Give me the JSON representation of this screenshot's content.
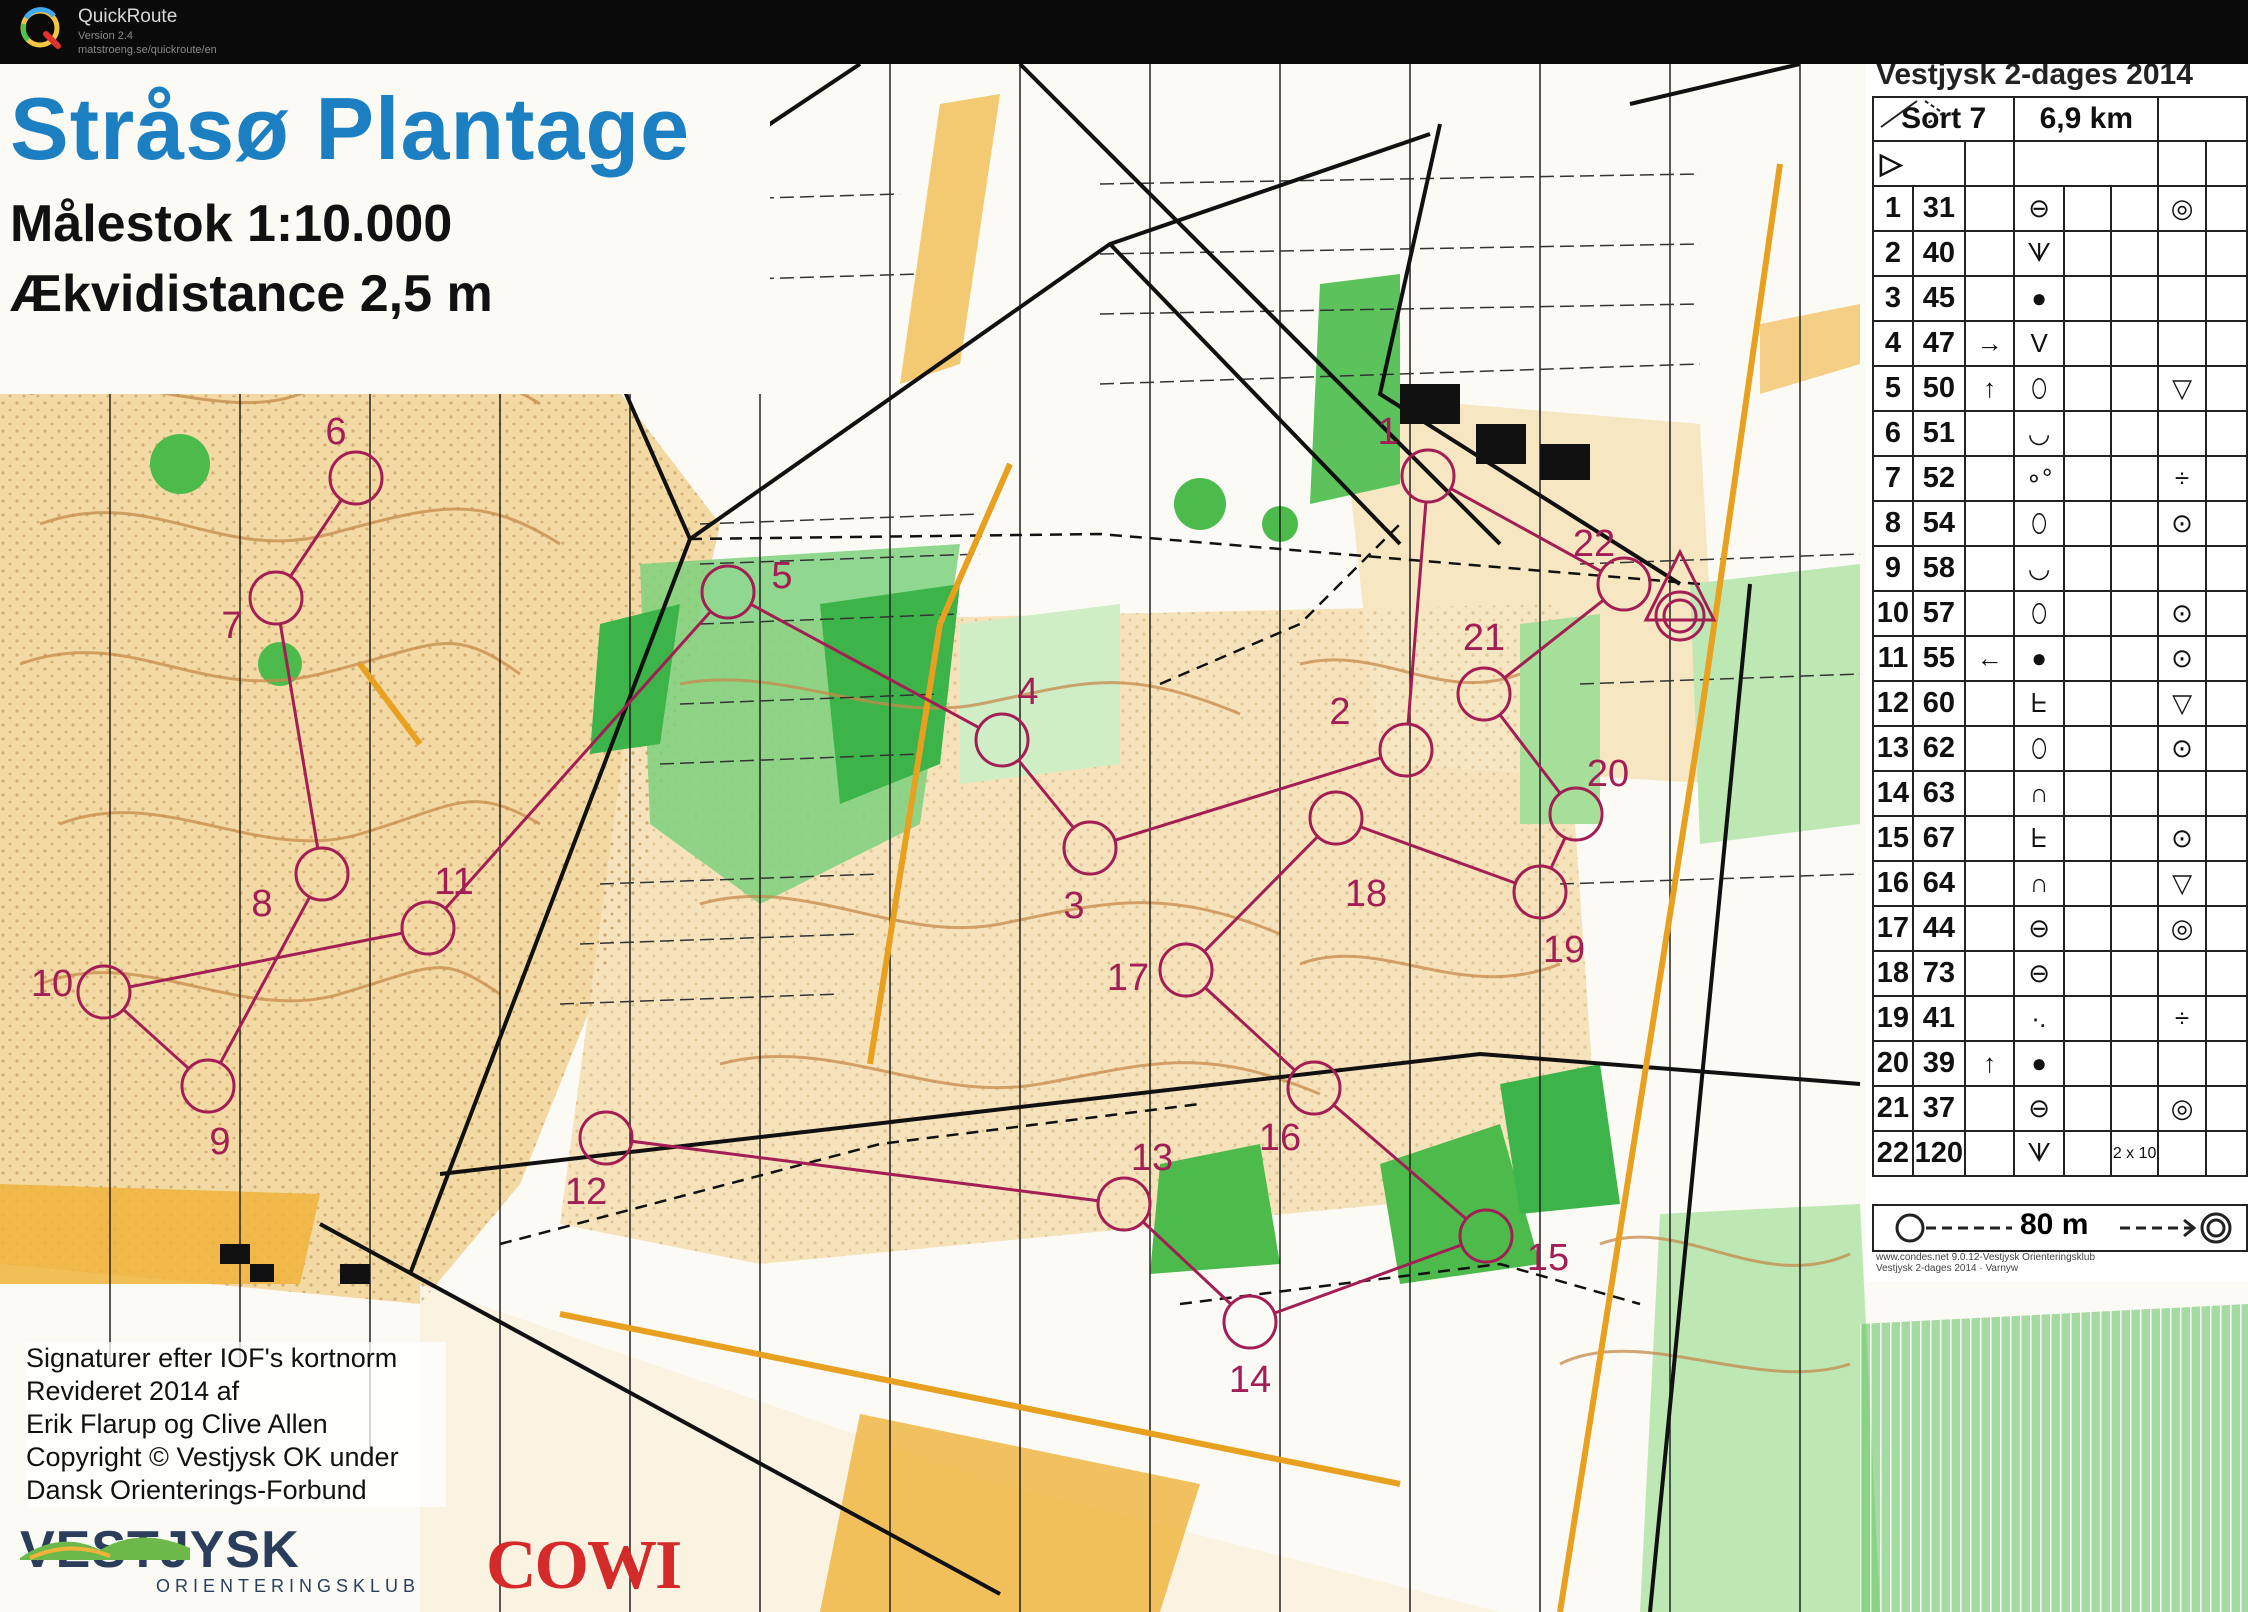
{
  "app": {
    "name": "QuickRoute",
    "version": "Version 2.4",
    "url": "matstroeng.se/quickroute/en"
  },
  "map": {
    "title": "Stråsø Plantage",
    "scale": "Målestok 1:10.000",
    "contour": "Ækvidistance 2,5 m",
    "credits": [
      "Signaturer efter IOF's kortnorm",
      "Revideret 2014 af",
      "Erik Flarup og Clive Allen",
      "Copyright © Vestjysk OK under",
      "Dansk Orienterings-Forbund"
    ],
    "club_name": "VESTJYSK",
    "club_sub": "ORIENTERINGSKLUB",
    "sponsor": "COWI",
    "course_color": "#a21e54",
    "controls": [
      {
        "label": "1"
      },
      {
        "label": "2"
      },
      {
        "label": "3"
      },
      {
        "label": "4"
      },
      {
        "label": "5"
      },
      {
        "label": "6"
      },
      {
        "label": "7"
      },
      {
        "label": "8"
      },
      {
        "label": "9"
      },
      {
        "label": "10"
      },
      {
        "label": "11"
      },
      {
        "label": "12"
      },
      {
        "label": "13"
      },
      {
        "label": "14"
      },
      {
        "label": "15"
      },
      {
        "label": "16"
      },
      {
        "label": "17"
      },
      {
        "label": "18"
      },
      {
        "label": "19"
      },
      {
        "label": "20"
      },
      {
        "label": "21"
      },
      {
        "label": "22"
      }
    ]
  },
  "descriptions": {
    "event": "Vestjysk 2-dages 2014",
    "course": "Sort 7",
    "length": "6,9 km",
    "start_symbol": "▷",
    "rows": [
      {
        "num": "1",
        "code": "31",
        "dir": "",
        "feature": "⊖",
        "detail": "",
        "extra": "◎"
      },
      {
        "num": "2",
        "code": "40",
        "dir": "",
        "feature": "ᗐ",
        "detail": "",
        "extra": ""
      },
      {
        "num": "3",
        "code": "45",
        "dir": "",
        "feature": "●",
        "detail": "",
        "extra": ""
      },
      {
        "num": "4",
        "code": "47",
        "dir": "→",
        "feature": "V",
        "detail": "",
        "extra": ""
      },
      {
        "num": "5",
        "code": "50",
        "dir": "↑",
        "feature": "⬯",
        "detail": "",
        "extra": "▽"
      },
      {
        "num": "6",
        "code": "51",
        "dir": "",
        "feature": "◡",
        "detail": "",
        "extra": ""
      },
      {
        "num": "7",
        "code": "52",
        "dir": "",
        "feature": "∘°",
        "detail": "",
        "extra": "÷"
      },
      {
        "num": "8",
        "code": "54",
        "dir": "",
        "feature": "⬯",
        "detail": "",
        "extra": "⊙"
      },
      {
        "num": "9",
        "code": "58",
        "dir": "",
        "feature": "◡",
        "detail": "",
        "extra": ""
      },
      {
        "num": "10",
        "code": "57",
        "dir": "",
        "feature": "⬯",
        "detail": "",
        "extra": "⊙"
      },
      {
        "num": "11",
        "code": "55",
        "dir": "←",
        "feature": "●",
        "detail": "",
        "extra": "⊙"
      },
      {
        "num": "12",
        "code": "60",
        "dir": "",
        "feature": "ᖶ",
        "detail": "",
        "extra": "▽"
      },
      {
        "num": "13",
        "code": "62",
        "dir": "",
        "feature": "⬯",
        "detail": "",
        "extra": "⊙"
      },
      {
        "num": "14",
        "code": "63",
        "dir": "",
        "feature": "∩",
        "detail": "",
        "extra": ""
      },
      {
        "num": "15",
        "code": "67",
        "dir": "",
        "feature": "ᖶ",
        "detail": "",
        "extra": "⊙"
      },
      {
        "num": "16",
        "code": "64",
        "dir": "",
        "feature": "∩",
        "detail": "",
        "extra": "▽"
      },
      {
        "num": "17",
        "code": "44",
        "dir": "",
        "feature": "⊖",
        "detail": "",
        "extra": "◎"
      },
      {
        "num": "18",
        "code": "73",
        "dir": "",
        "feature": "⊖",
        "detail": "",
        "extra": ""
      },
      {
        "num": "19",
        "code": "41",
        "dir": "",
        "feature": "∙.",
        "detail": "",
        "extra": "÷"
      },
      {
        "num": "20",
        "code": "39",
        "dir": "↑",
        "feature": "●",
        "detail": "",
        "extra": ""
      },
      {
        "num": "21",
        "code": "37",
        "dir": "",
        "feature": "⊖",
        "detail": "",
        "extra": "◎"
      },
      {
        "num": "22",
        "code": "120",
        "dir": "",
        "feature": "ᗐ",
        "detail": "2 x 10",
        "extra": ""
      }
    ],
    "finish": "80 m",
    "footnote_1": "www.condes.net 9.0.12-Vestjysk Orienteringsklub",
    "footnote_2": "Vestjysk 2-dages 2014 · Varnyw"
  }
}
